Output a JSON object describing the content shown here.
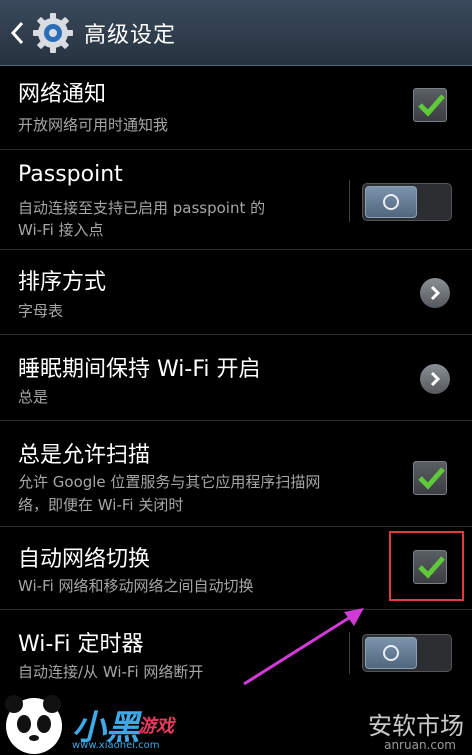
{
  "header": {
    "title": "高级设定"
  },
  "items": [
    {
      "title": "网络通知",
      "subtitle": "开放网络可用时通知我",
      "control": "checkbox",
      "checked": true
    },
    {
      "title": "Passpoint",
      "subtitle": "自动连接至支持已启用 passpoint 的",
      "subtitle2": "Wi-Fi 接入点",
      "control": "toggle",
      "on": false
    },
    {
      "title": "排序方式",
      "subtitle": "字母表",
      "control": "chevron"
    },
    {
      "title": "睡眠期间保持 Wi-Fi 开启",
      "subtitle": "总是",
      "control": "chevron"
    },
    {
      "title": "总是允许扫描",
      "subtitle": "允许 Google 位置服务与其它应用程序扫描网",
      "subtitle2": "络，即便在 Wi-Fi 关闭时",
      "control": "checkbox",
      "checked": true
    },
    {
      "title": "自动网络切换",
      "subtitle": "Wi-Fi 网络和移动网络之间自动切换",
      "control": "checkbox",
      "checked": true
    },
    {
      "title": "Wi-Fi 定时器",
      "subtitle": "自动连接/从 Wi-Fi 网络断开",
      "control": "toggle",
      "on": false
    }
  ],
  "watermarks": {
    "left_brand": "小黑",
    "left_brand2": "游戏",
    "left_url": "www.xiaohei.com",
    "right_text": "安软市场",
    "right_url": "anruan.com"
  },
  "colors": {
    "accent_check": "#5fc93a",
    "highlight": "#e03a3a",
    "arrow": "#d23ad8"
  }
}
